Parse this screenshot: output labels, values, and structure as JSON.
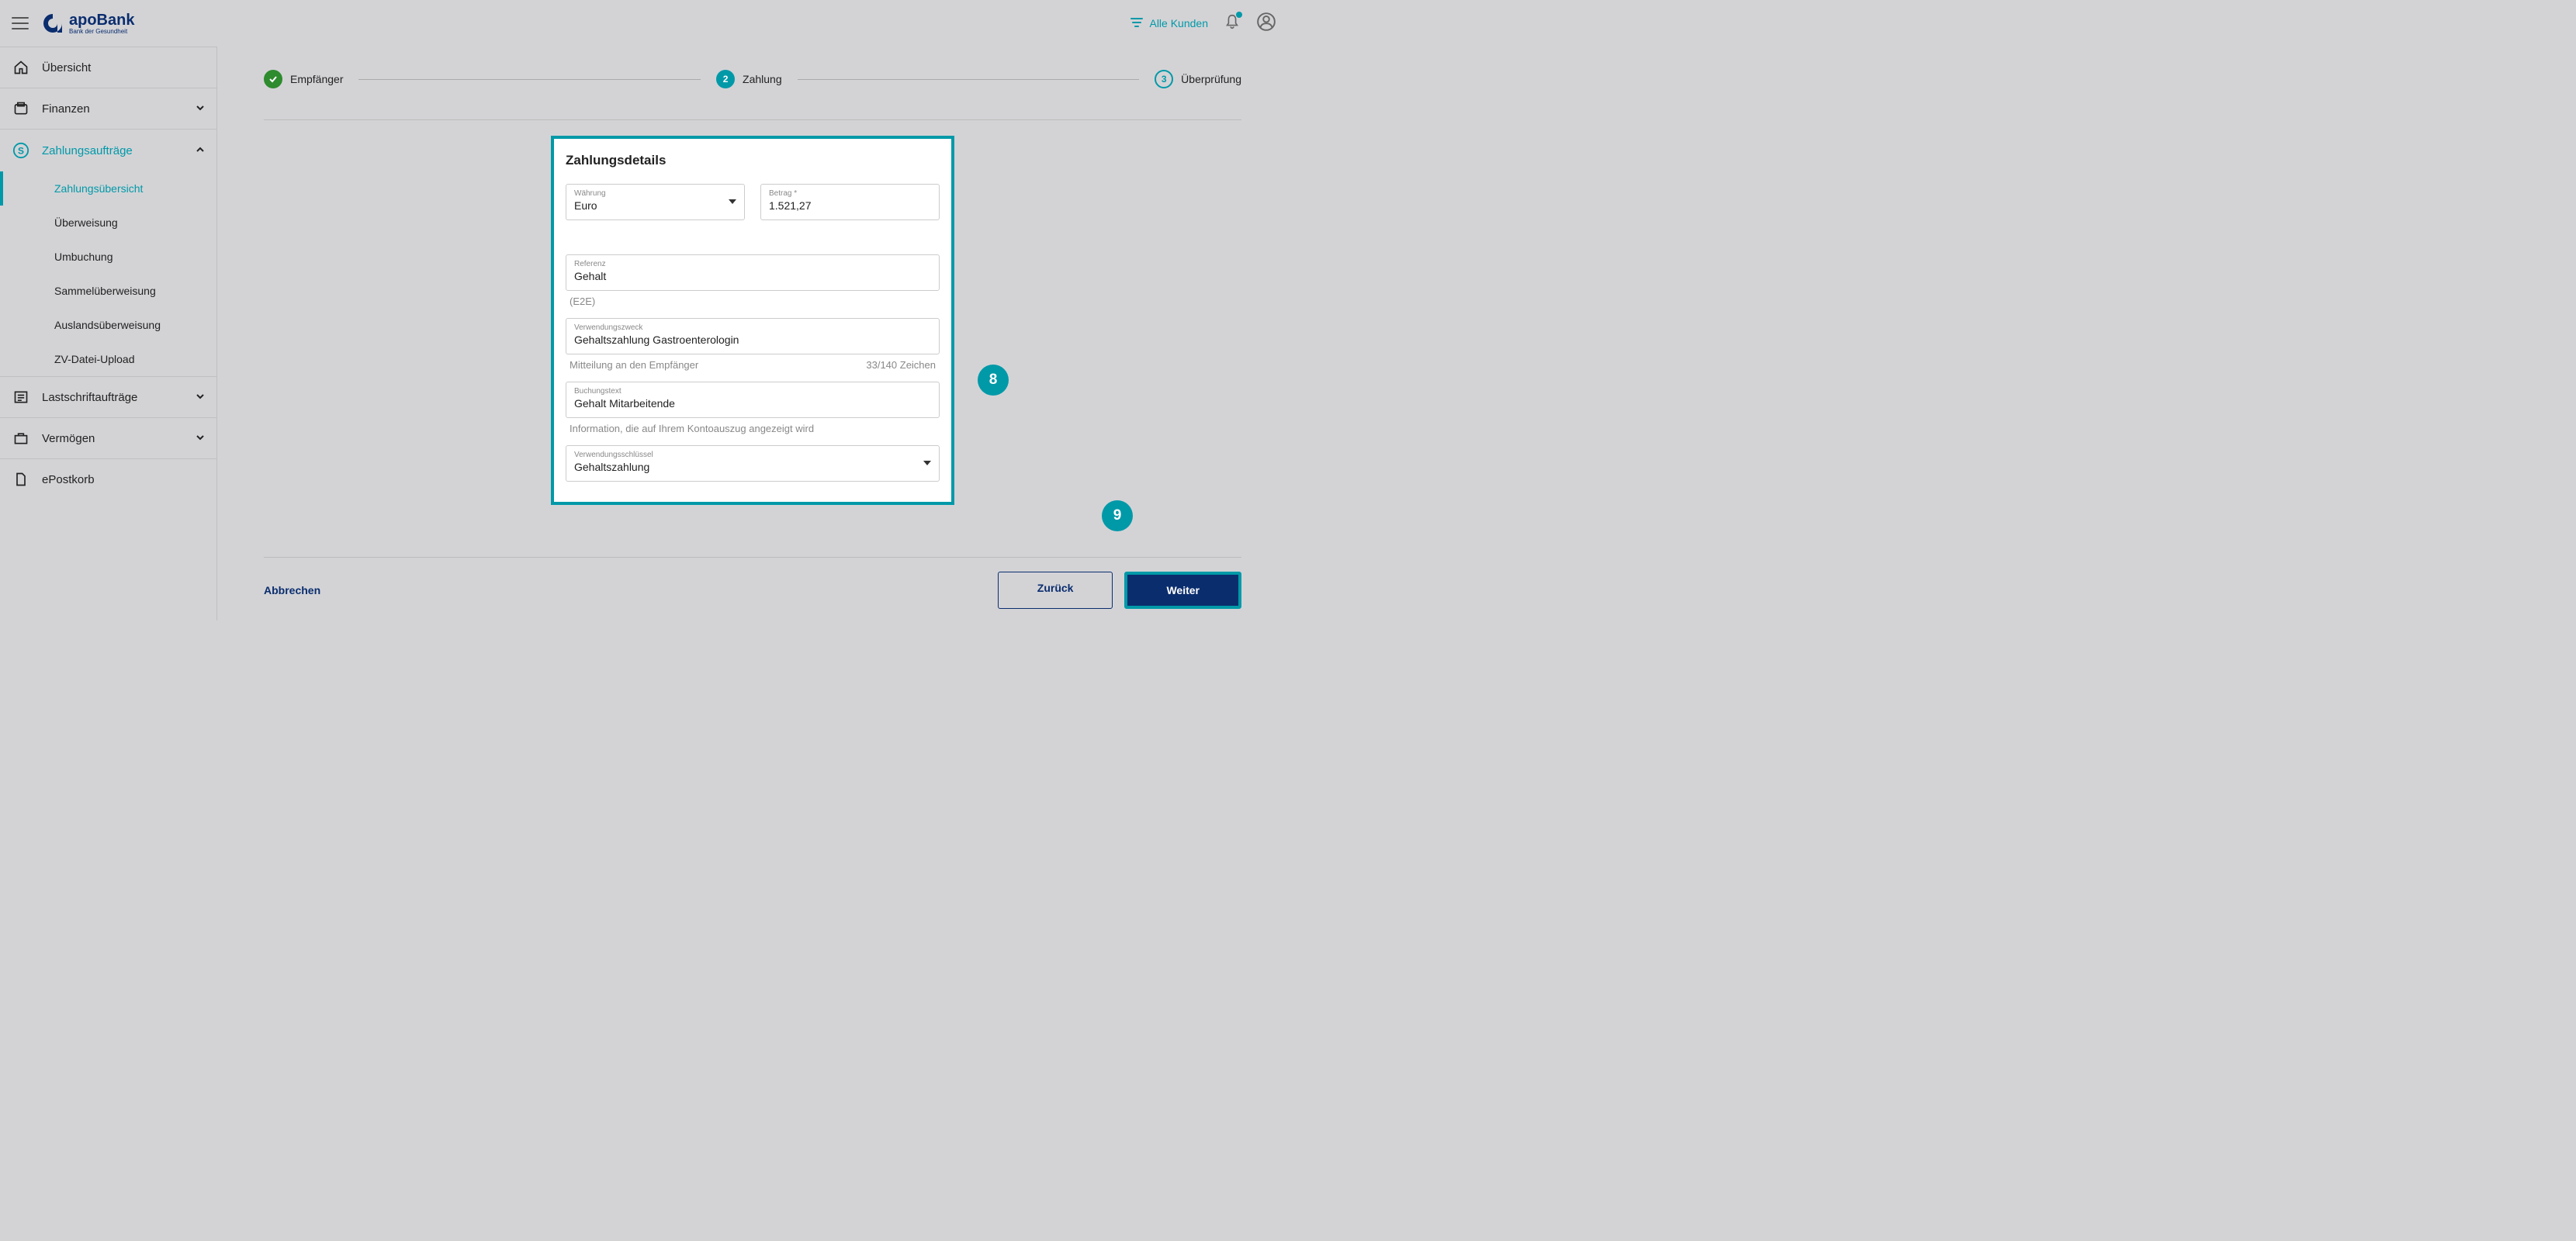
{
  "header": {
    "brand": "apoBank",
    "brand_sub": "Bank der Gesundheit",
    "filter_label": "Alle Kunden"
  },
  "sidebar": {
    "uebersicht": "Übersicht",
    "finanzen": "Finanzen",
    "zahlungsauftraege": "Zahlungsaufträge",
    "zahlungsuebersicht": "Zahlungsübersicht",
    "ueberweisung": "Überweisung",
    "umbuchung": "Umbuchung",
    "sammelueberweisung": "Sammelüberweisung",
    "auslandsueberweisung": "Auslandsüberweisung",
    "zvdatei": "ZV-Datei-Upload",
    "lastschrift": "Lastschriftaufträge",
    "vermoegen": "Vermögen",
    "epostkorb": "ePostkorb"
  },
  "steps": {
    "s1": "Empfänger",
    "s2": "Zahlung",
    "s2_num": "2",
    "s3": "Überprüfung",
    "s3_num": "3"
  },
  "card": {
    "title": "Zahlungsdetails",
    "currency_label": "Währung",
    "currency_value": "Euro",
    "amount_label": "Betrag *",
    "amount_value": "1.521,27",
    "reference_label": "Referenz",
    "reference_value": "Gehalt",
    "e2e": "(E2E)",
    "purpose_label": "Verwendungszweck",
    "purpose_value": "Gehaltszahlung Gastroenterologin",
    "purpose_helper": "Mitteilung an den Empfänger",
    "purpose_count": "33/140 Zeichen",
    "booking_label": "Buchungstext",
    "booking_value": "Gehalt Mitarbeitende",
    "booking_helper": "Information, die auf Ihrem Kontoauszug angezeigt wird",
    "key_label": "Verwendungsschlüssel",
    "key_value": "Gehaltszahlung"
  },
  "footer": {
    "cancel": "Abbrechen",
    "back": "Zurück",
    "next": "Weiter"
  },
  "badges": {
    "b8": "8",
    "b9": "9"
  }
}
